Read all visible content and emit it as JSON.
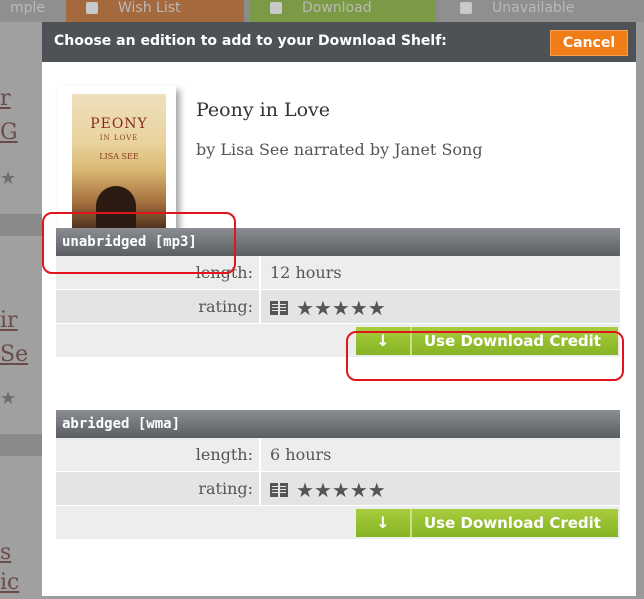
{
  "background": {
    "tabs": [
      "mple",
      "Wish List",
      "Download",
      "Unavailable"
    ],
    "left_fragments": [
      "r",
      "G",
      "ir",
      "Se",
      "s",
      "ic"
    ],
    "tab_colors": {
      "wish": "#a4693d",
      "download": "#7b9a45"
    }
  },
  "dialog": {
    "title": "Choose an edition to add to your Download Shelf:",
    "cancel_label": "Cancel",
    "cover": {
      "title": "PEONY",
      "subtitle": "IN LOVE",
      "author": "LISA SEE"
    },
    "book_title": "Peony in Love",
    "byline": "by Lisa See narrated by Janet Song",
    "editions": [
      {
        "name": "unabridged [mp3]",
        "length_label": "length:",
        "length_value": "12 hours",
        "rating_label": "rating:",
        "rating_stars": 5,
        "button_label": "Use Download Credit"
      },
      {
        "name": "abridged [wma]",
        "length_label": "length:",
        "length_value": "6 hours",
        "rating_label": "rating:",
        "rating_stars": 5,
        "button_label": "Use Download Credit"
      }
    ]
  },
  "icons": {
    "download_arrow": "↓",
    "star": "★",
    "book": "book-icon"
  },
  "colors": {
    "header": "#4e5256",
    "cancel": "#f07d17",
    "credit_button": "#86b324",
    "annotation": "#e0161c"
  }
}
